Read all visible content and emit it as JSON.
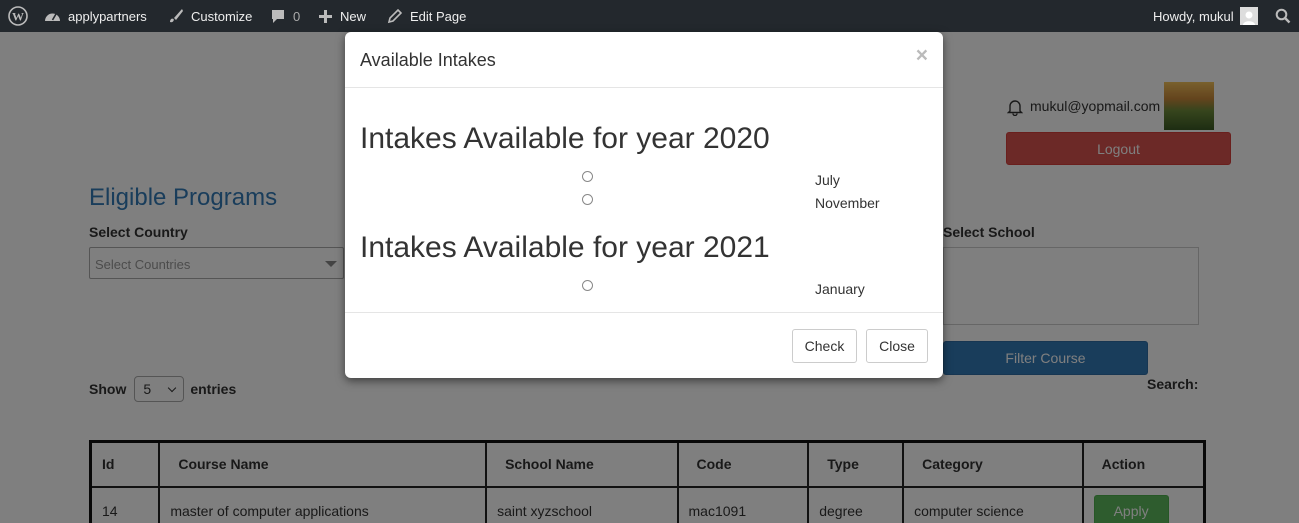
{
  "admin_bar": {
    "site_name": "applypartners",
    "customize": "Customize",
    "comments_count": "0",
    "new": "New",
    "edit_page": "Edit Page",
    "greeting": "Howdy, mukul"
  },
  "user": {
    "email": "mukul@yopmail.com",
    "logout_label": "Logout"
  },
  "filters": {
    "section_title": "Eligible Programs",
    "country_label": "Select Country",
    "country_placeholder": "Select Countries",
    "school_label": "Select School",
    "filter_button": "Filter Course"
  },
  "table_controls": {
    "show_label": "Show",
    "page_length": "5",
    "entries_label": "entries",
    "search_label": "Search:"
  },
  "table": {
    "headers": [
      "Id",
      "Course Name",
      "School Name",
      "Code",
      "Type",
      "Category",
      "Action"
    ],
    "rows": [
      {
        "id": "14",
        "course": "master of computer applications",
        "school": "saint xyzschool",
        "code": "mac1091",
        "type": "degree",
        "category": "computer science",
        "action": "Apply"
      }
    ]
  },
  "modal": {
    "title": "Available Intakes",
    "close_symbol": "×",
    "years": [
      {
        "heading": "Intakes Available for year 2020",
        "months": [
          "July",
          "November"
        ]
      },
      {
        "heading": "Intakes Available for year 2021",
        "months": [
          "January"
        ]
      }
    ],
    "check_button": "Check",
    "close_button": "Close"
  },
  "colors": {
    "admin_bar": "#23282d",
    "primary": "#337ab7",
    "danger": "#d9534f",
    "success": "#5cb85c"
  }
}
